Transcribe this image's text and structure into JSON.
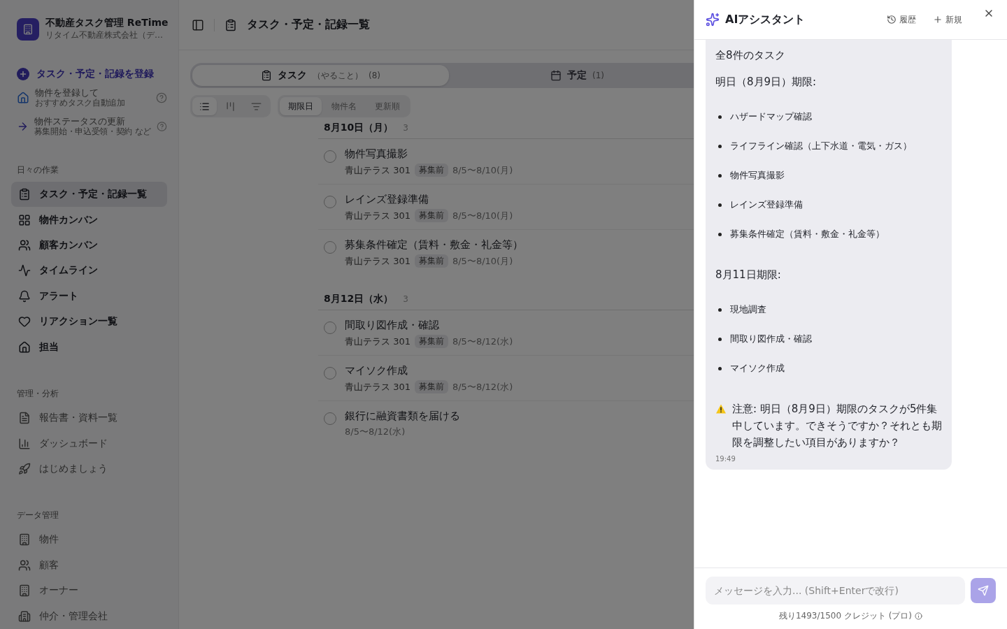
{
  "brand": {
    "title": "不動産タスク管理 ReTime",
    "subtitle": "リタイム不動産株式会社（デ…"
  },
  "register_button": "タスク・予定・記録を登録",
  "quick_actions": [
    {
      "title": "物件を登録して",
      "subtitle": "おすすめタスク自動追加"
    },
    {
      "title": "物件ステータスの更新",
      "subtitle": "募集開始・申込受領・契約 など"
    }
  ],
  "nav_sections": [
    {
      "heading": "日々の作業",
      "items": [
        {
          "label": "タスク・予定・記録一覧",
          "selected": true
        },
        {
          "label": "物件カンバン",
          "selected": false
        },
        {
          "label": "顧客カンバン",
          "selected": false
        },
        {
          "label": "タイムライン",
          "selected": false
        },
        {
          "label": "アラート",
          "selected": false
        },
        {
          "label": "リアクション一覧",
          "selected": false
        },
        {
          "label": "担当",
          "selected": false
        }
      ]
    },
    {
      "heading": "管理・分析",
      "items": [
        {
          "label": "報告書・資料一覧",
          "selected": false
        },
        {
          "label": "ダッシュボード",
          "selected": false
        },
        {
          "label": "はじめましょう",
          "selected": false
        }
      ]
    },
    {
      "heading": "データ管理",
      "items": [
        {
          "label": "物件",
          "selected": false
        },
        {
          "label": "顧客",
          "selected": false
        },
        {
          "label": "オーナー",
          "selected": false
        },
        {
          "label": "仲介・管理会社",
          "selected": false
        }
      ]
    }
  ],
  "page_title": "タスク・予定・記録一覧",
  "tabs": [
    {
      "label": "タスク",
      "sublabel": "（やること）",
      "count": "(8)",
      "selected": true
    },
    {
      "label": "予定",
      "count": "(1)",
      "selected": false
    }
  ],
  "view_modes": [
    {
      "selected": true
    },
    {
      "selected": false
    },
    {
      "selected": false
    }
  ],
  "sort_options": [
    {
      "label": "期限日",
      "selected": true
    },
    {
      "label": "物件名",
      "selected": false
    },
    {
      "label": "更新順",
      "selected": false
    }
  ],
  "groups": [
    {
      "date": "8月10日（月）",
      "count": "3",
      "tasks": [
        {
          "title": "物件写真撮影",
          "property": "青山テラス 301",
          "status": "募集前",
          "period": "8/5〜8/10(月)",
          "checked": false
        },
        {
          "title": "レインズ登録準備",
          "property": "青山テラス 301",
          "status": "募集前",
          "period": "8/5〜8/10(月)",
          "checked": false
        },
        {
          "title": "募集条件確定（賃料・敷金・礼金等）",
          "property": "青山テラス 301",
          "status": "募集前",
          "period": "8/5〜8/10(月)",
          "checked": false
        }
      ]
    },
    {
      "date": "8月12日（水）",
      "count": "3",
      "tasks": [
        {
          "title": "間取り図作成・確認",
          "property": "青山テラス 301",
          "status": "募集前",
          "period": "8/5〜8/12(水)",
          "checked": false
        },
        {
          "title": "マイソク作成",
          "property": "青山テラス 301",
          "status": "募集前",
          "period": "8/5〜8/12(水)",
          "checked": false
        },
        {
          "title": "銀行に融資書類を届ける",
          "period": "8/5〜8/12(水)",
          "checked": false
        }
      ]
    }
  ],
  "assistant": {
    "title": "AIアシスタント",
    "history_button": "履歴",
    "new_button": "新規",
    "message": {
      "blocks": [
        {
          "kind": "paragraph",
          "text": "全8件のタスク"
        },
        {
          "kind": "paragraph",
          "text": "明日（8月9日）期限:"
        },
        {
          "kind": "list",
          "items": [
            "ハザードマップ確認",
            "ライフライン確認（上下水道・電気・ガス）",
            "物件写真撮影",
            "レインズ登録準備",
            "募集条件確定（賃料・敷金・礼金等）"
          ]
        },
        {
          "kind": "paragraph",
          "text": "8月11日期限:"
        },
        {
          "kind": "list",
          "items": [
            "現地調査",
            "間取り図作成・確認",
            "マイソク作成"
          ]
        },
        {
          "kind": "warning",
          "text": "注意: 明日（8月9日）期限のタスクが5件集中しています。できそうですか？それとも期限を調整したい項目がありますか？"
        }
      ],
      "time": "19:49"
    },
    "input_placeholder": "メッセージを入力... (Shift+Enterで改行)",
    "credits": "残り1493/1500 クレジット (プロ)"
  }
}
